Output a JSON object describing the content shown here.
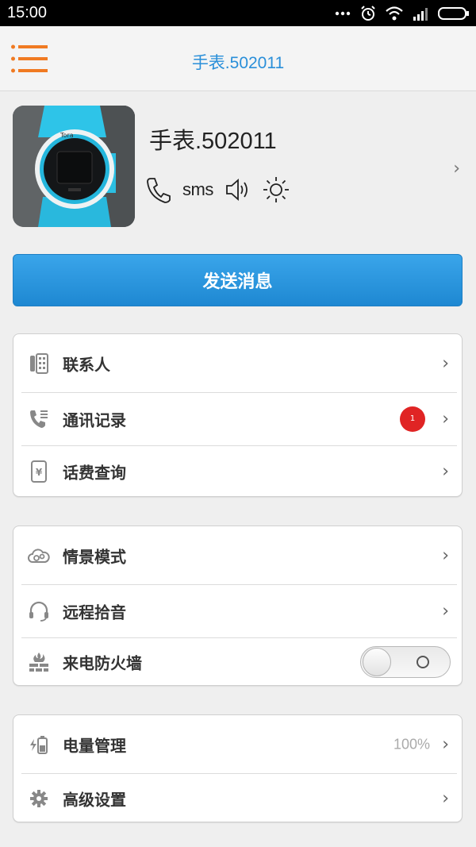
{
  "status_bar": {
    "time": "15:00",
    "icons": [
      "more-dots-icon",
      "alarm-icon",
      "wifi-icon",
      "signal-icon",
      "battery-icon"
    ]
  },
  "header": {
    "title": "手表.502011",
    "menu_icon": "menu-icon",
    "accent": "#f07a22"
  },
  "device": {
    "name": "手表.502011",
    "actions": [
      {
        "name": "call",
        "icon": "phone-icon"
      },
      {
        "name": "sms",
        "label": "sms"
      },
      {
        "name": "sound",
        "icon": "speaker-icon"
      },
      {
        "name": "brightness",
        "icon": "sun-icon"
      }
    ],
    "chevron": "›"
  },
  "send_button": {
    "label": "发送消息",
    "color": "#2b95de"
  },
  "menu_groups": [
    [
      {
        "label": "联系人",
        "icon": "contacts-phone-icon",
        "chevron": "›"
      },
      {
        "label": "通讯记录",
        "icon": "call-log-icon",
        "badge": "1",
        "chevron": "›"
      },
      {
        "label": "话费查询",
        "icon": "phone-bill-icon",
        "chevron": "›"
      }
    ],
    [
      {
        "label": "情景模式",
        "icon": "scene-mode-icon",
        "chevron": "›"
      },
      {
        "label": "远程拾音",
        "icon": "headset-icon",
        "chevron": "›"
      },
      {
        "label": "来电防火墙",
        "icon": "firewall-icon",
        "toggle_on": false
      }
    ],
    [
      {
        "label": "电量管理",
        "icon": "battery-charge-icon",
        "value": "100%",
        "chevron": "›"
      },
      {
        "label": "高级设置",
        "icon": "gear-icon",
        "chevron": "›"
      }
    ]
  ]
}
